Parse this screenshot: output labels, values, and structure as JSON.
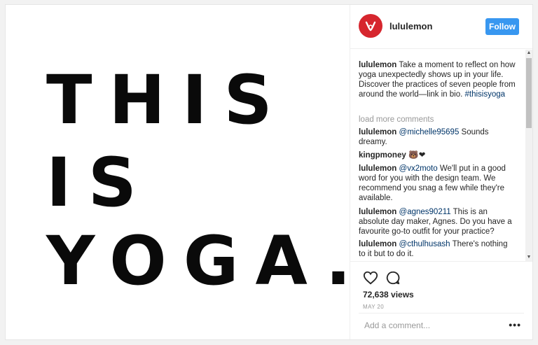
{
  "post": {
    "image_text": [
      "THIS",
      "IS",
      "YOGA."
    ],
    "username": "lululemon",
    "follow_label": "Follow",
    "caption": {
      "user": "lululemon",
      "text": "Take a moment to reflect on how yoga unexpectedly shows up in your life. Discover the practices of seven people from around the world—link in bio. ",
      "hashtag": "#thisisyoga"
    },
    "load_more": "load more comments",
    "comments": [
      {
        "user": "lululemon",
        "mention": "@michelle95695",
        "text": " Sounds dreamy."
      },
      {
        "user": "kingpmoney",
        "mention": "",
        "text": " 🐻❤"
      },
      {
        "user": "lululemon",
        "mention": "@vx2moto",
        "text": " We'll put in a good word for you with the design team. We recommend you snag a few while they're available."
      },
      {
        "user": "lululemon",
        "mention": "@agnes90211",
        "text": " This is an absolute day maker, Agnes. Do you have a favourite go-to outfit for your practice?"
      },
      {
        "user": "lululemon",
        "mention": "@cthulhusash",
        "text": " There's nothing to it but to do it."
      }
    ],
    "views": "72,638 views",
    "date": "MAY 20",
    "add_comment_placeholder": "Add a comment...",
    "more_options": "•••"
  },
  "colors": {
    "accent": "#3897f0",
    "brand": "#d6262e",
    "mention": "#003569"
  },
  "icons": {
    "like": "heart-icon",
    "comment": "comment-bubble-icon",
    "avatar": "lululemon-logo-icon"
  }
}
